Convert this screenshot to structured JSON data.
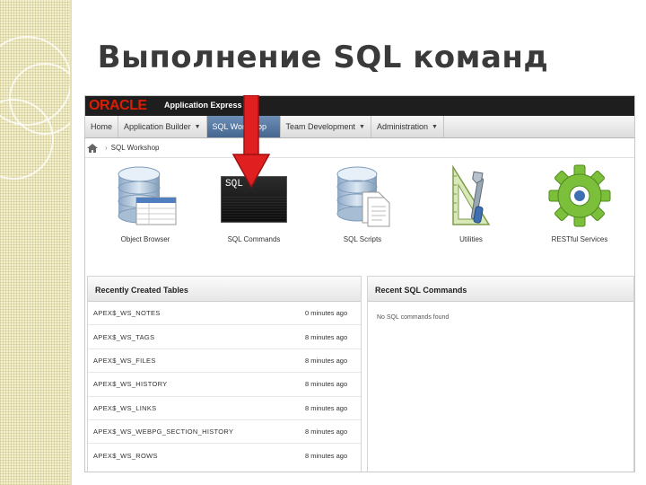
{
  "slide": {
    "title": "Выполнение SQL команд"
  },
  "app": {
    "brand": "ORACLE",
    "product": "Application Express"
  },
  "nav": {
    "items": [
      {
        "label": "Home",
        "has_menu": false
      },
      {
        "label": "Application Builder",
        "has_menu": true
      },
      {
        "label": "SQL Workshop",
        "has_menu": true,
        "active": true
      },
      {
        "label": "Team Development",
        "has_menu": true
      },
      {
        "label": "Administration",
        "has_menu": true
      }
    ]
  },
  "breadcrumb": {
    "current": "SQL Workshop"
  },
  "tiles": [
    {
      "label": "Object Browser",
      "icon": "database-browser-icon"
    },
    {
      "label": "SQL Commands",
      "icon": "sql-commands-icon",
      "box_text": "SQL >"
    },
    {
      "label": "SQL Scripts",
      "icon": "database-scripts-icon"
    },
    {
      "label": "Utilities",
      "icon": "tools-icon"
    },
    {
      "label": "RESTful Services",
      "icon": "gear-icon"
    }
  ],
  "recent_tables": {
    "title": "Recently Created Tables",
    "rows": [
      {
        "name": "APEX$_WS_NOTES",
        "age": "0 minutes ago"
      },
      {
        "name": "APEX$_WS_TAGS",
        "age": "8 minutes ago"
      },
      {
        "name": "APEX$_WS_FILES",
        "age": "8 minutes ago"
      },
      {
        "name": "APEX$_WS_HISTORY",
        "age": "8 minutes ago"
      },
      {
        "name": "APEX$_WS_LINKS",
        "age": "8 minutes ago"
      },
      {
        "name": "APEX$_WS_WEBPG_SECTION_HISTORY",
        "age": "8 minutes ago"
      },
      {
        "name": "APEX$_WS_ROWS",
        "age": "8 minutes ago"
      }
    ]
  },
  "recent_sql": {
    "title": "Recent SQL Commands",
    "empty_text": "No SQL commands found"
  },
  "colors": {
    "brand_red": "#d81e05",
    "active_tab": "#4d6f97",
    "arrow_red": "#e02020",
    "deco_bg": "#f3f0cf"
  }
}
